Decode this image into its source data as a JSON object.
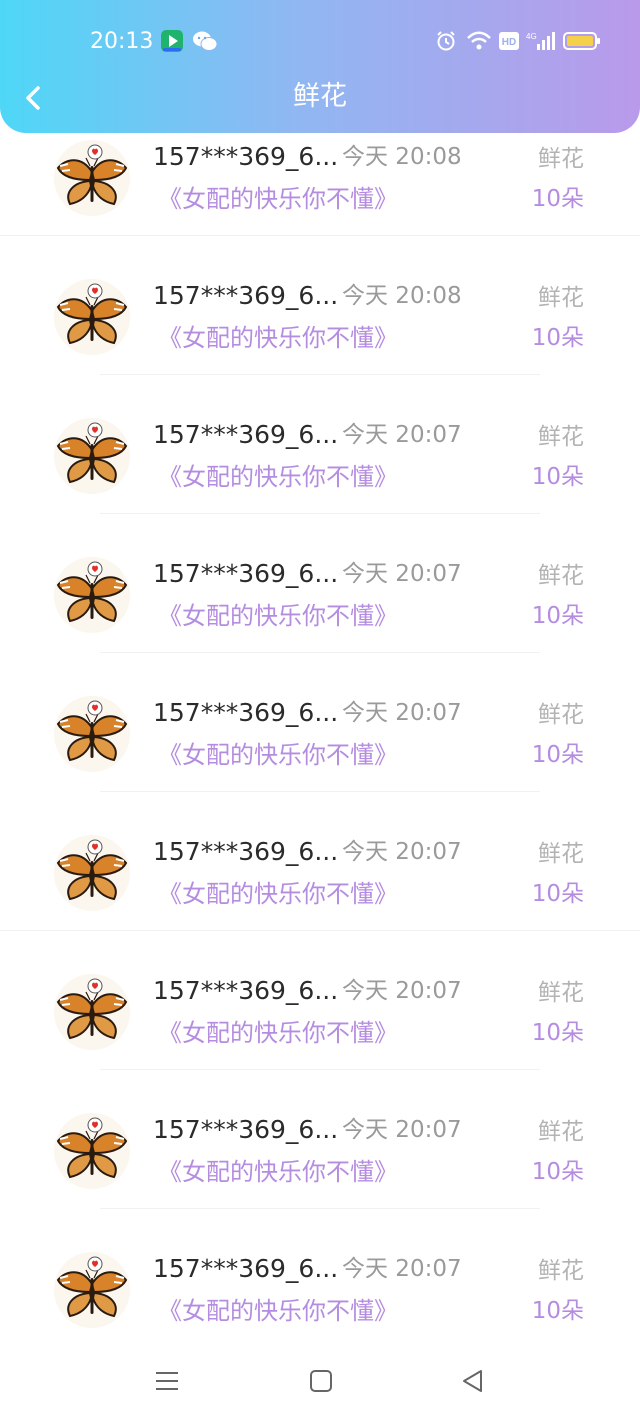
{
  "status_bar": {
    "time": "20:13",
    "network": "4G"
  },
  "header": {
    "title": "鲜花"
  },
  "colors": {
    "header_gradient_start": "#4ed7f6",
    "header_gradient_end": "#b99aea",
    "accent_purple": "#b58de0",
    "text_gray": "#9a9a9a"
  },
  "records": [
    {
      "user": "157***369_6...",
      "time": "今天 20:08",
      "type": "鲜花",
      "book": "《女配的快乐你不懂》",
      "count": "10朵"
    },
    {
      "user": "157***369_6...",
      "time": "今天 20:08",
      "type": "鲜花",
      "book": "《女配的快乐你不懂》",
      "count": "10朵"
    },
    {
      "user": "157***369_6...",
      "time": "今天 20:07",
      "type": "鲜花",
      "book": "《女配的快乐你不懂》",
      "count": "10朵"
    },
    {
      "user": "157***369_6...",
      "time": "今天 20:07",
      "type": "鲜花",
      "book": "《女配的快乐你不懂》",
      "count": "10朵"
    },
    {
      "user": "157***369_6...",
      "time": "今天 20:07",
      "type": "鲜花",
      "book": "《女配的快乐你不懂》",
      "count": "10朵"
    },
    {
      "user": "157***369_6...",
      "time": "今天 20:07",
      "type": "鲜花",
      "book": "《女配的快乐你不懂》",
      "count": "10朵"
    },
    {
      "user": "157***369_6...",
      "time": "今天 20:07",
      "type": "鲜花",
      "book": "《女配的快乐你不懂》",
      "count": "10朵"
    },
    {
      "user": "157***369_6...",
      "time": "今天 20:07",
      "type": "鲜花",
      "book": "《女配的快乐你不懂》",
      "count": "10朵"
    },
    {
      "user": "157***369_6...",
      "time": "今天 20:07",
      "type": "鲜花",
      "book": "《女配的快乐你不懂》",
      "count": "10朵"
    }
  ],
  "icons": {
    "back": "chevron-left-icon",
    "avatar": "butterfly-avatar-icon",
    "nav_menu": "menu-icon",
    "nav_home": "square-home-icon",
    "nav_back": "triangle-back-icon"
  }
}
